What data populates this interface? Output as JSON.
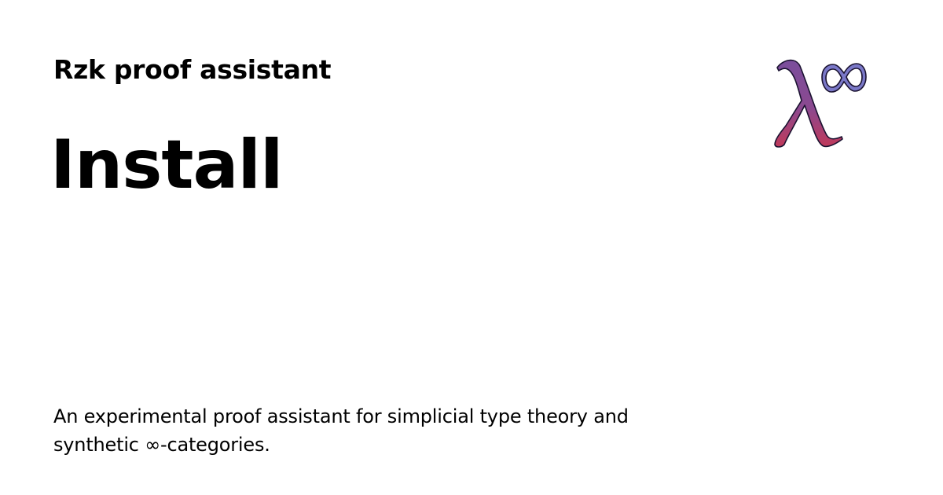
{
  "header": {
    "site_name": "Rzk proof assistant"
  },
  "page": {
    "title": "Install",
    "description": "An experimental proof assistant for simplicial type theory and synthetic ∞-categories."
  },
  "logo": {
    "icon": "lambda-infinity-logo-icon",
    "colors": {
      "lambda_top": "#7a4e9c",
      "lambda_bottom": "#c0395a",
      "infinity": "#7a78c8",
      "outline": "#1a1230"
    }
  }
}
